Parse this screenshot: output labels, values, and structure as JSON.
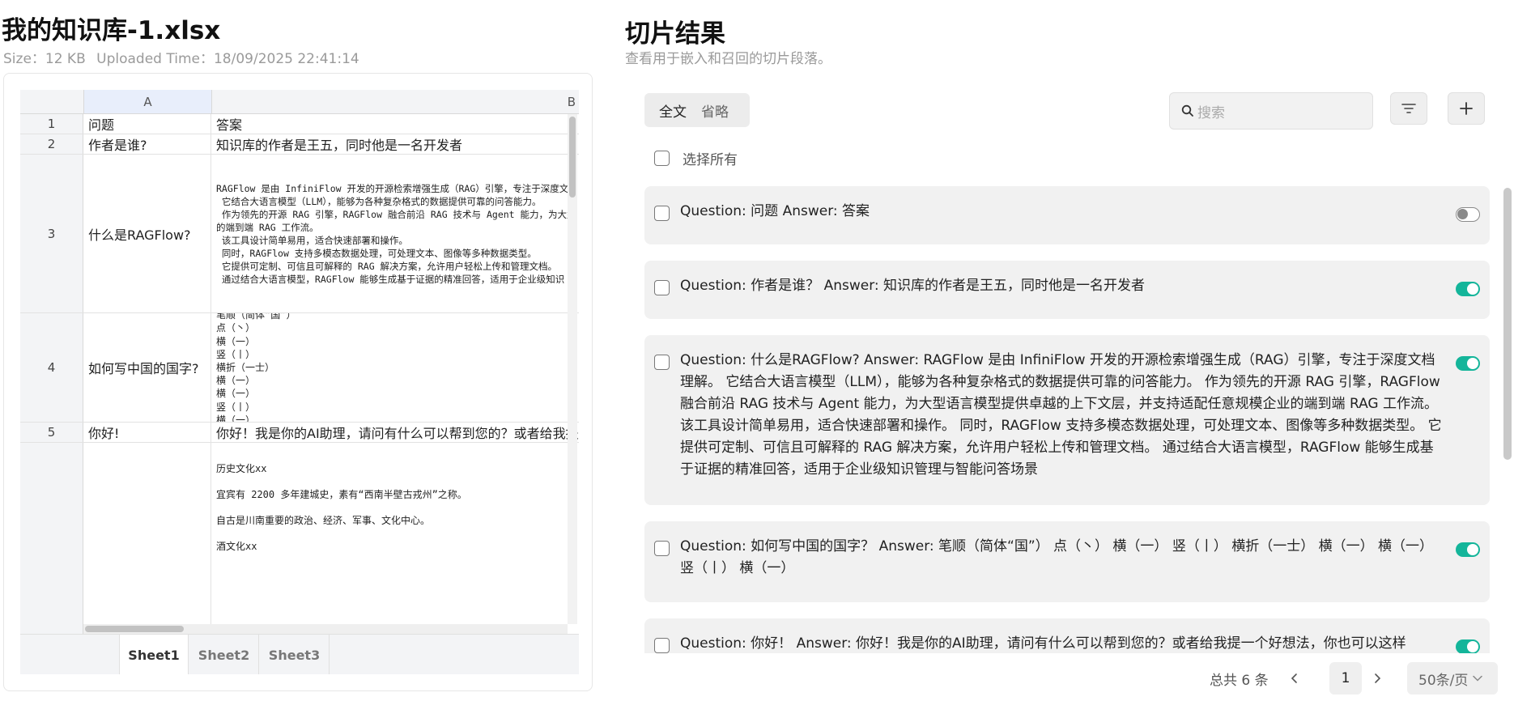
{
  "file": {
    "title": "我的知识库-1.xlsx",
    "size_label": "Size：12 KB",
    "uploaded_label": "Uploaded Time：18/09/2025 22:41:14"
  },
  "sheet": {
    "columns": [
      "A",
      "B"
    ],
    "rows": [
      {
        "num": "1",
        "a": "问题",
        "b": "答案"
      },
      {
        "num": "2",
        "a": "作者是谁?",
        "b": "知识库的作者是王五，同时他是一名开发者"
      },
      {
        "num": "3",
        "a": "什么是RAGFlow?",
        "b_lines": [
          "RAGFlow 是由 InfiniFlow 开发的开源检索增强生成（RAG）引擎，专注于深度文档",
          " 它结合大语言模型（LLM），能够为各种复杂格式的数据提供可靠的问答能力。",
          " 作为领先的开源 RAG 引擎，RAGFlow 融合前沿 RAG 技术与 Agent 能力，为大型",
          "的端到端 RAG 工作流。",
          " 该工具设计简单易用，适合快速部署和操作。",
          " 同时，RAGFlow 支持多模态数据处理，可处理文本、图像等多种数据类型。",
          " 它提供可定制、可信且可解释的 RAG 解决方案，允许用户轻松上传和管理文档。",
          " 通过结合大语言模型，RAGFlow 能够生成基于证据的精准回答，适用于企业级知识"
        ]
      },
      {
        "num": "4",
        "a": "如何写中国的国字?",
        "b_lines": [
          "笔顺（简体“国”）",
          "点（丶）",
          "横（一）",
          "竖（丨）",
          "横折（一士）",
          "横（一）",
          "横（一）",
          "竖（丨）",
          "横（一）"
        ]
      },
      {
        "num": "5",
        "a": "你好!",
        "b": "你好！我是你的AI助理，请问有什么可以帮到您的？或者给我提一个好想法"
      },
      {
        "num": "",
        "a": "",
        "b_lines": [
          "历史文化xx",
          "宜宾有 2200 多年建城史，素有“西南半壁古戎州”之称。",
          "自古是川南重要的政治、经济、军事、文化中心。",
          "酒文化xx"
        ]
      }
    ],
    "tabs": [
      "Sheet1",
      "Sheet2",
      "Sheet3"
    ]
  },
  "chunks": {
    "title": "切片结果",
    "subtitle": "查看用于嵌入和召回的切片段落。",
    "view_full": "全文",
    "view_brief": "省略",
    "search_placeholder": "搜索",
    "select_all": "选择所有",
    "items": [
      {
        "text": "Question: 问题 Answer: 答案",
        "enabled": false
      },
      {
        "text": "Question: 作者是谁？ Answer: 知识库的作者是王五，同时他是一名开发者",
        "enabled": true
      },
      {
        "text": "Question: 什么是RAGFlow? Answer: RAGFlow 是由 InfiniFlow 开发的开源检索增强生成（RAG）引擎，专注于深度文档理解。 它结合大语言模型（LLM），能够为各种复杂格式的数据提供可靠的问答能力。 作为领先的开源 RAG 引擎，RAGFlow 融合前沿 RAG 技术与 Agent 能力，为大型语言模型提供卓越的上下文层，并支持适配任意规模企业的端到端 RAG 工作流。 该工具设计简单易用，适合快速部署和操作。 同时，RAGFlow 支持多模态数据处理，可处理文本、图像等多种数据类型。 它提供可定制、可信且可解释的 RAG 解决方案，允许用户轻松上传和管理文档。 通过结合大语言模型，RAGFlow 能够生成基于证据的精准回答，适用于企业级知识管理与智能问答场景",
        "enabled": true
      },
      {
        "text": "Question: 如何写中国的国字？ Answer: 笔顺（简体“国”） 点（丶） 横（一） 竖（丨） 横折（一士） 横（一） 横（一） 竖（丨） 横（一）",
        "enabled": true
      },
      {
        "text": "Question: 你好！ Answer: 你好！我是你的AI助理，请问有什么可以帮到您的？或者给我提一个好想法，你也可以这样",
        "enabled": true
      }
    ]
  },
  "pagination": {
    "total": "总共 6 条",
    "current_page": "1",
    "page_size": "50条/页"
  }
}
